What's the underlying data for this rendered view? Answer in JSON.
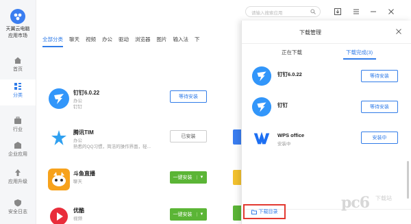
{
  "app": {
    "name_line1": "天翼云电脑",
    "name_line2": "应用市场"
  },
  "sidebar": {
    "items": [
      {
        "label": "首页",
        "icon": "home-icon"
      },
      {
        "label": "分类",
        "icon": "grid-icon",
        "active": true
      },
      {
        "label": "行业",
        "icon": "briefcase-icon"
      },
      {
        "label": "企业应用",
        "icon": "building-icon"
      },
      {
        "label": "应用升级",
        "icon": "upgrade-icon"
      },
      {
        "label": "安全日志",
        "icon": "shield-icon"
      }
    ]
  },
  "search": {
    "placeholder": "请输入搜索应用"
  },
  "tabs": [
    "全部分类",
    "聊天",
    "视频",
    "办公",
    "驱动",
    "浏览器",
    "图片",
    "输入法",
    "下"
  ],
  "apps": [
    {
      "name": "钉钉6.0.22",
      "category": "办公",
      "desc": "钉钉",
      "button": "等待安装",
      "style": "outline"
    },
    {
      "name": "腾讯TIM",
      "category": "办公",
      "desc": "熟悉的QQ习惯，简洁的操作界面，轻...",
      "button": "已安装",
      "style": "gray"
    },
    {
      "name": "斗鱼直播",
      "category": "聊天",
      "desc": "",
      "button": "一键安装",
      "style": "green"
    },
    {
      "name": "优酷",
      "category": "视频",
      "desc": "",
      "button": "一键安装",
      "style": "green"
    }
  ],
  "download_panel": {
    "title": "下载管理",
    "tab_downloading": "正在下载",
    "tab_done": "下载完成(3)",
    "items": [
      {
        "name": "钉钉6.0.22",
        "status": "",
        "button": "等待安装"
      },
      {
        "name": "钉钉",
        "status": "",
        "button": "等待安装"
      },
      {
        "name": "WPS office",
        "status": "安装中",
        "button": "安装中"
      }
    ],
    "dir_button": "下载目录"
  },
  "watermark": {
    "main": "pc6",
    "sub": "下载站"
  },
  "colors": {
    "accent": "#2f7be8",
    "green": "#5bb536",
    "highlight": "#e2382f"
  }
}
